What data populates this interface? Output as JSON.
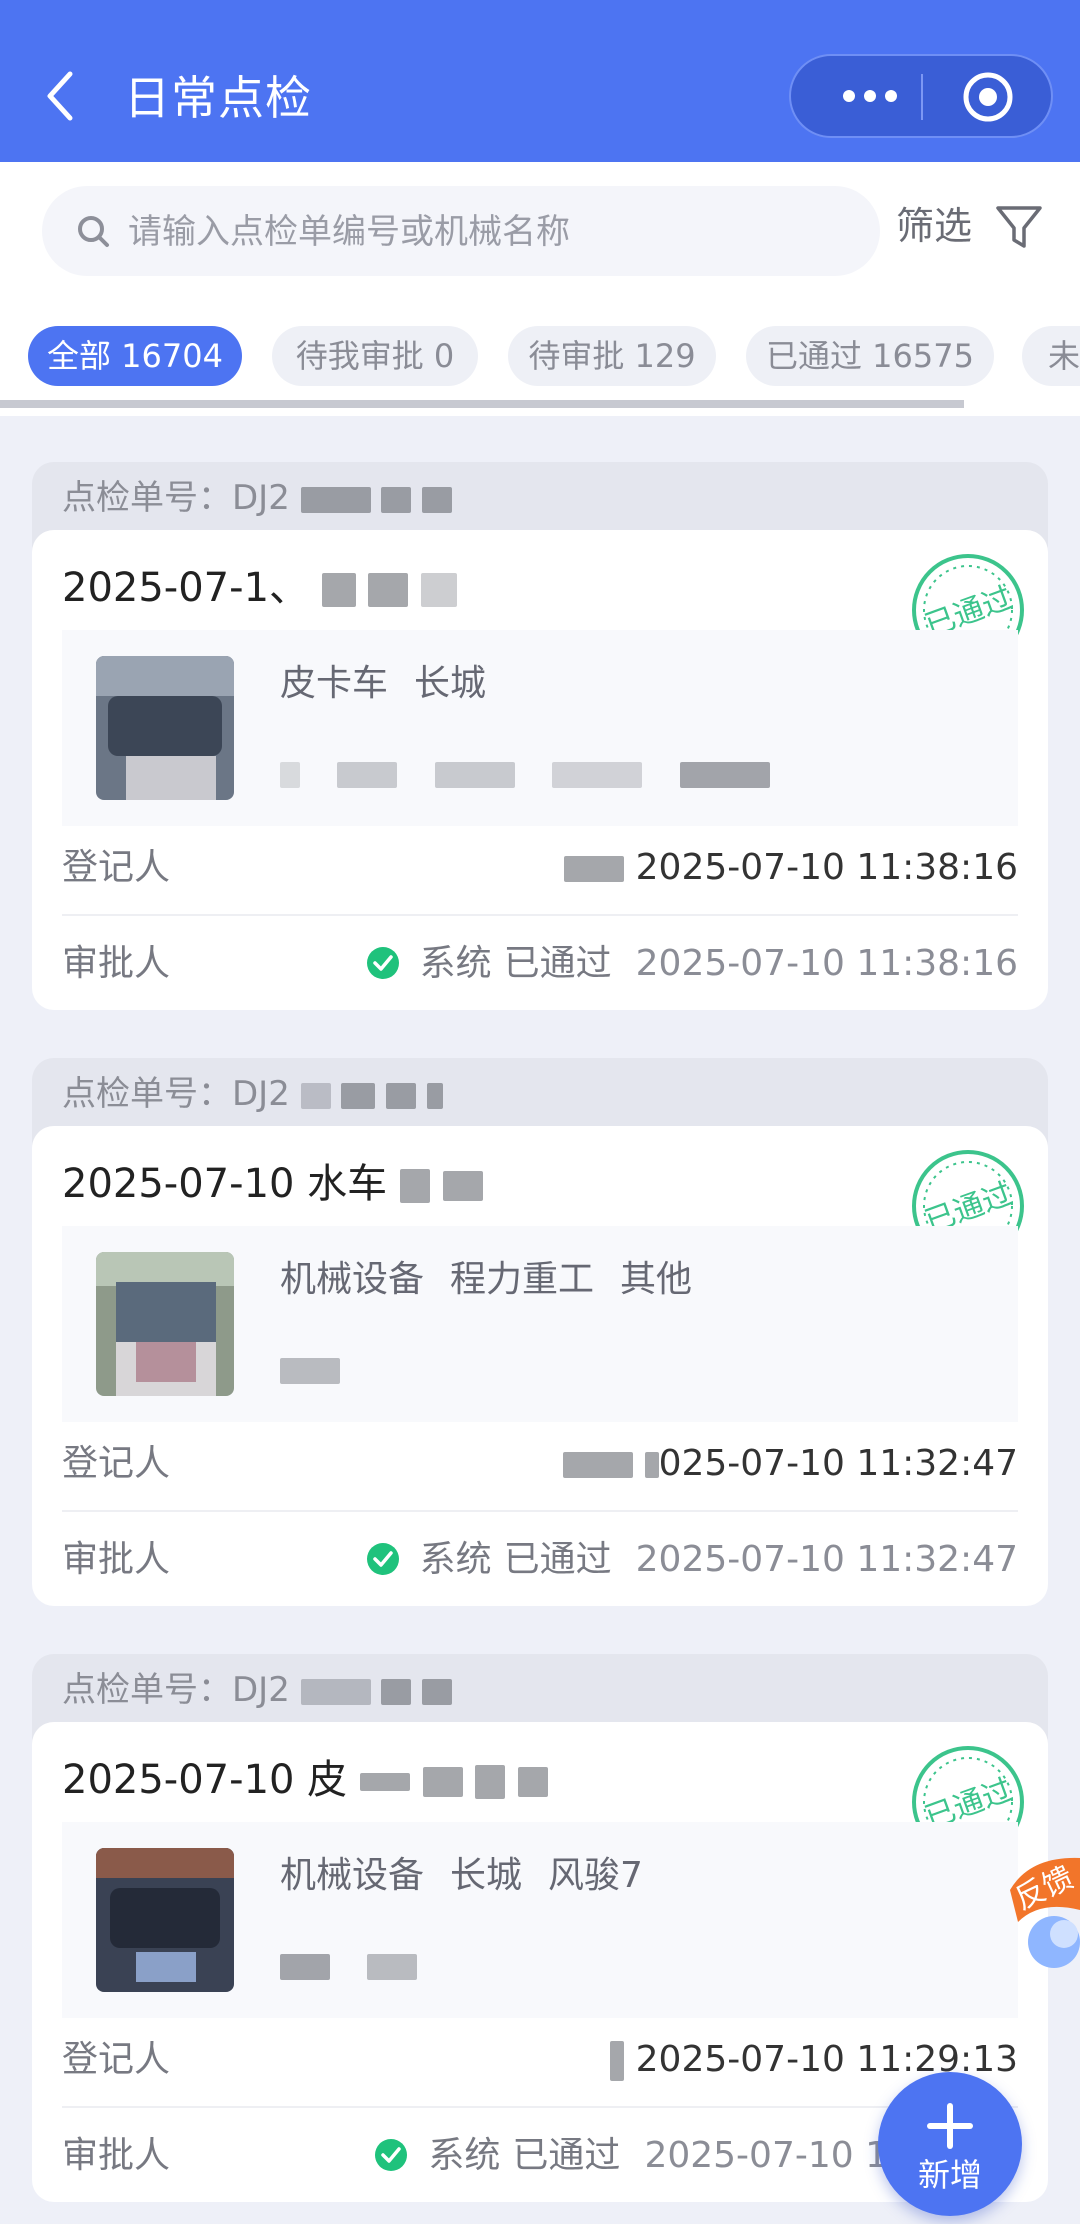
{
  "header": {
    "title": "日常点检",
    "bg_color": "#4d74f2"
  },
  "search": {
    "placeholder": "请输入点检单编号或机械名称",
    "filter_label": "筛选"
  },
  "tabs": [
    {
      "label": "全部 16704",
      "active": true
    },
    {
      "label": "待我审批 0",
      "active": false
    },
    {
      "label": "待审批 129",
      "active": false
    },
    {
      "label": "已通过 16575",
      "active": false
    },
    {
      "label": "未",
      "active": false
    }
  ],
  "records": [
    {
      "order_prefix": "点检单号：DJ2",
      "title": "2025-07-1、",
      "stamp": "已通过",
      "tags": [
        "皮卡车",
        "长城"
      ],
      "registrar_label": "登记人",
      "registrar_time": "2025-07-10 11:38:16",
      "approver_label": "审批人",
      "approver_name": "系统",
      "approver_status": "已通过",
      "approver_time": "2025-07-10 11:38:16"
    },
    {
      "order_prefix": "点检单号：DJ2",
      "title": "2025-07-10 水车",
      "stamp": "已通过",
      "tags": [
        "机械设备",
        "程力重工",
        "其他"
      ],
      "registrar_label": "登记人",
      "registrar_time": "025-07-10 11:32:47",
      "approver_label": "审批人",
      "approver_name": "系统",
      "approver_status": "已通过",
      "approver_time": "2025-07-10 11:32:47"
    },
    {
      "order_prefix": "点检单号：DJ2",
      "title": "2025-07-10 皮",
      "stamp": "已通过",
      "tags": [
        "机械设备",
        "长城",
        "风骏7"
      ],
      "registrar_label": "登记人",
      "registrar_time": "2025-07-10 11:29:13",
      "approver_label": "审批人",
      "approver_name": "系统",
      "approver_status": "已通过",
      "approver_time": "2025-07-10 1"
    }
  ],
  "fab": {
    "label": "新增"
  },
  "feedback": {
    "label": "反馈"
  },
  "colors": {
    "accent": "#4d74f2",
    "stamp_green": "#3cc48c",
    "check_green": "#1fc27c"
  },
  "icons": [
    "back-icon",
    "more-icon",
    "target-icon",
    "search-icon",
    "filter-icon",
    "check-circle-icon",
    "plus-icon"
  ]
}
